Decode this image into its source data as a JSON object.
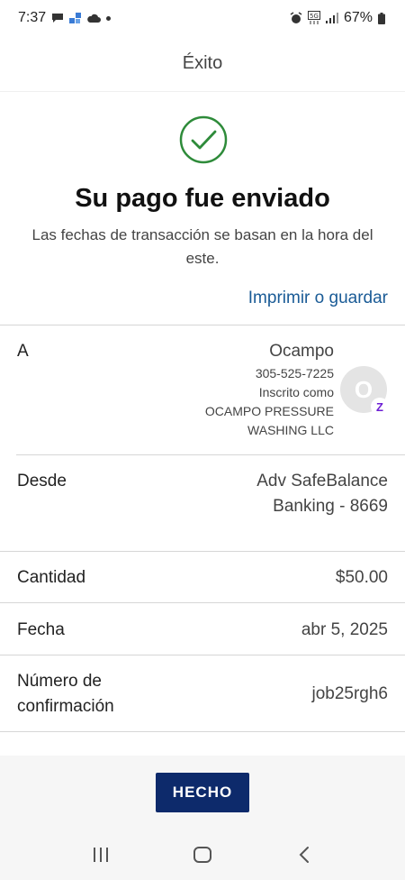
{
  "status_bar": {
    "time": "7:37",
    "battery": "67%",
    "left_icons": [
      "chat-bubble-icon",
      "app-grid-icon",
      "cloud-icon",
      "dot-icon"
    ],
    "right_icons": [
      "alarm-icon",
      "5g-icon",
      "signal-icon",
      "battery-icon"
    ]
  },
  "header": {
    "title": "Éxito"
  },
  "success": {
    "icon": "checkmark-circle-icon",
    "title": "Su pago fue enviado",
    "subtitle": "Las fechas de transacción se basan en la hora del este."
  },
  "actions": {
    "print_link": "Imprimir o guardar",
    "done_button": "HECHO"
  },
  "details": {
    "to": {
      "label": "A",
      "name": "Ocampo",
      "phone": "305-525-7225",
      "enrolled_label": "Inscrito como",
      "business_line1": "OCAMPO PRESSURE",
      "business_line2": "WASHING LLC",
      "avatar_initial": "O",
      "badge_icon": "zelle-icon",
      "badge_letter": "Z"
    },
    "from": {
      "label": "Desde",
      "value_line1": "Adv SafeBalance",
      "value_line2": "Banking - 8669"
    },
    "amount": {
      "label": "Cantidad",
      "value": "$50.00"
    },
    "date": {
      "label": "Fecha",
      "value": "abr 5, 2025"
    },
    "confirmation": {
      "label_line1": "Número de",
      "label_line2": "confirmación",
      "value": "job25rgh6"
    }
  },
  "nav": [
    "recent-apps-icon",
    "home-icon",
    "back-icon"
  ],
  "colors": {
    "accent_link": "#1a5b96",
    "button_bg": "#0d2a6b",
    "success_green": "#2e8b3a",
    "zelle_purple": "#6d1ed4"
  }
}
